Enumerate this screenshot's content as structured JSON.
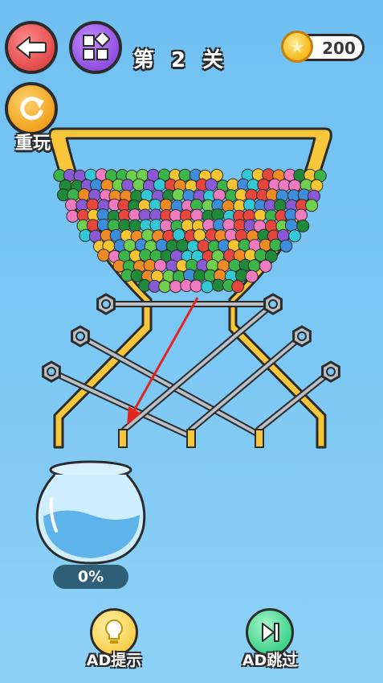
{
  "header": {
    "level_title": "第 2 关",
    "coins": "200"
  },
  "buttons": {
    "replay_label": "重玩",
    "hint_label": "AD提示",
    "skip_label": "AD跳过"
  },
  "jar": {
    "fill_percent_text": "0%",
    "fill_fraction": 0
  },
  "pins": {
    "count": 6
  },
  "ball_colors": [
    "#e8453c",
    "#3bb54a",
    "#f6c531",
    "#3c8ddb",
    "#f07ac0",
    "#8a5ad6",
    "#f08a24",
    "#32c8d6",
    "#1f8a3a",
    "#6fd04e"
  ],
  "icons": {
    "back": "back-arrow-icon",
    "menu": "grid-icon",
    "replay": "refresh-icon",
    "coin": "star-coin-icon",
    "hint": "lightbulb-icon",
    "skip": "skip-forward-icon"
  }
}
